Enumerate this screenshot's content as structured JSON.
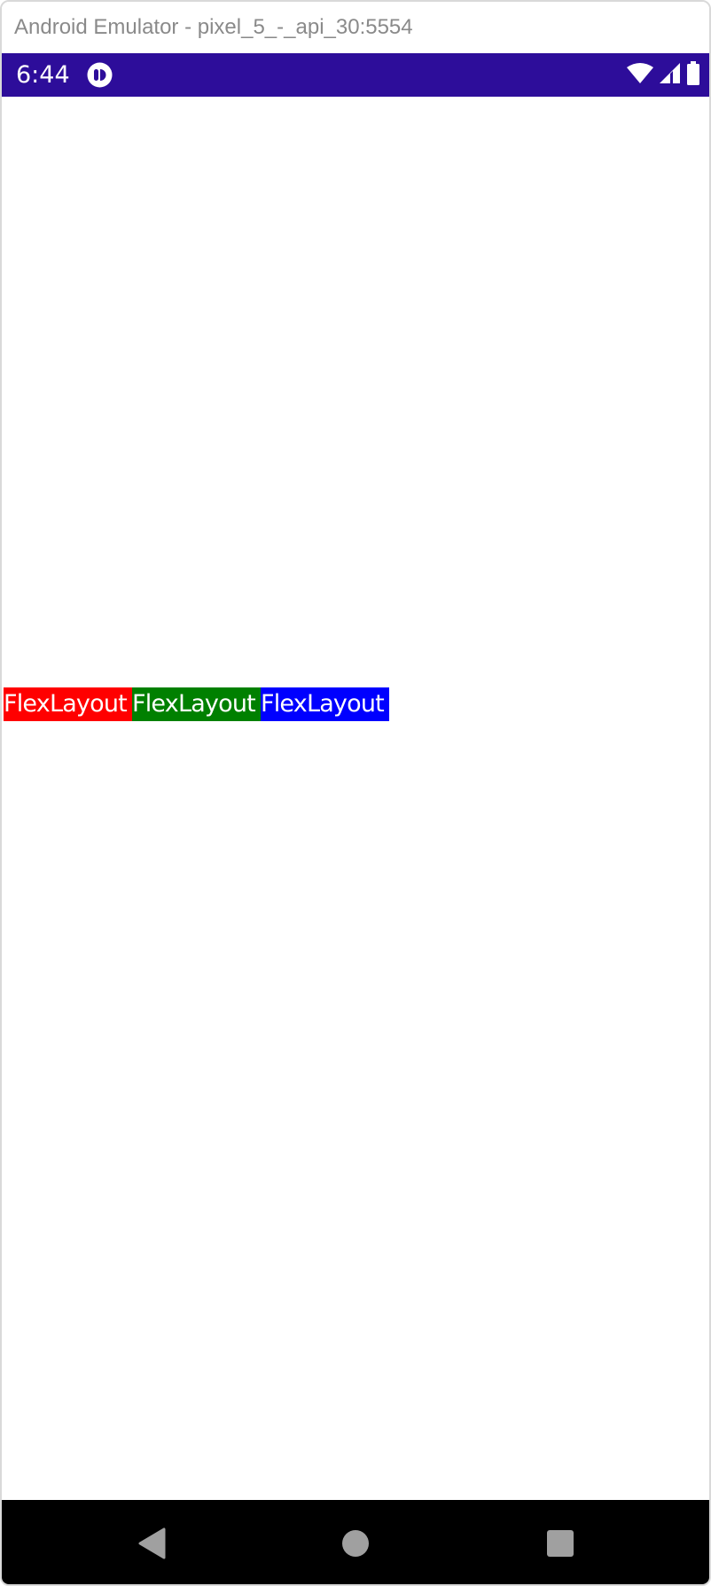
{
  "window": {
    "title": "Android Emulator - pixel_5_-_api_30:5554"
  },
  "status_bar": {
    "time": "6:44",
    "background_color": "#2d0d9a",
    "icons": [
      "app-notification-icon",
      "wifi-icon",
      "cellular-signal-icon",
      "battery-icon"
    ]
  },
  "flex_layout": {
    "items": [
      {
        "label": "FlexLayout",
        "color": "#ff0000"
      },
      {
        "label": "FlexLayout",
        "color": "#008000"
      },
      {
        "label": "FlexLayout",
        "color": "#0000ff"
      }
    ]
  },
  "navigation_bar": {
    "background_color": "#000000",
    "buttons": [
      "back-icon",
      "home-icon",
      "recents-icon"
    ]
  }
}
